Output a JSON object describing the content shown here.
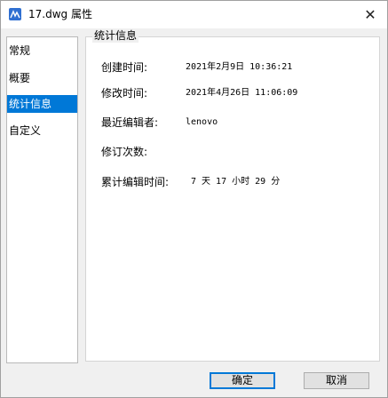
{
  "window": {
    "title": "17.dwg 属性",
    "close_glyph": "✕",
    "accent": "#0078d7"
  },
  "nav": {
    "items": [
      {
        "label": "常规"
      },
      {
        "label": "概要"
      },
      {
        "label": "统计信息"
      },
      {
        "label": "自定义"
      }
    ],
    "selected": "统计信息"
  },
  "stats": {
    "group_title": "统计信息",
    "created_label": "创建时间:",
    "created_value": "2021年2月9日  10:36:21",
    "modified_label": "修改时间:",
    "modified_value": "2021年4月26日  11:06:09",
    "last_editor_label": "最近编辑者:",
    "last_editor_value": "lenovo",
    "revision_label": "修订次数:",
    "revision_value": "",
    "total_edit_label": "累计编辑时间:",
    "total_edit_value": "7 天 17 小时 29 分"
  },
  "buttons": {
    "ok": "确定",
    "cancel": "取消"
  }
}
